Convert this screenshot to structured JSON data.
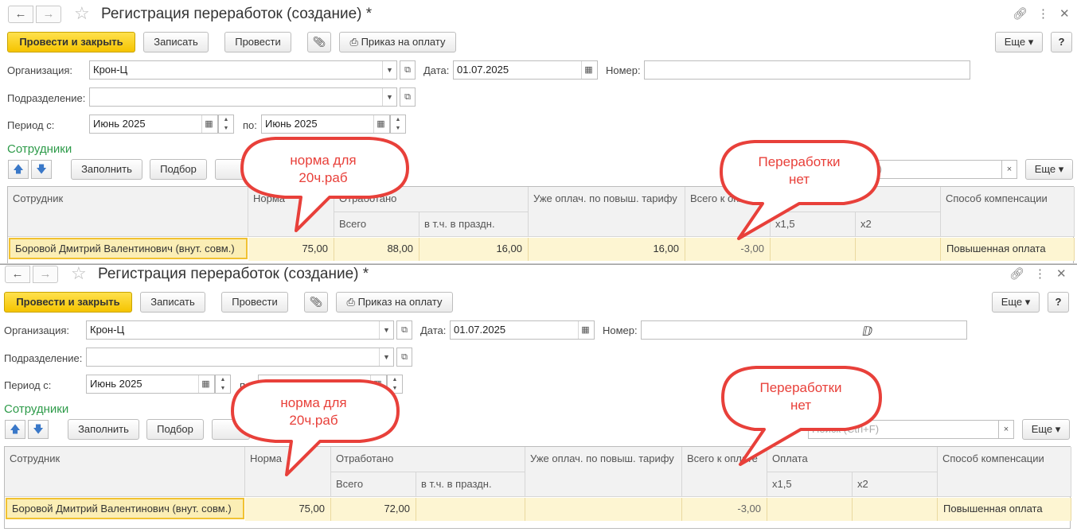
{
  "window": {
    "title": "Регистрация переработок (создание) *",
    "nav_back_icon": "arrow-left-icon",
    "nav_forward_icon": "arrow-right-icon",
    "favorite_icon": "star-icon",
    "link_icon": "link-icon",
    "more_icon": "more-vertical-icon",
    "close_icon": "close-icon"
  },
  "toolbar": {
    "post_close": "Провести и закрыть",
    "save": "Записать",
    "post": "Провести",
    "attach_icon": "paperclip-icon",
    "print_icon": "printer-icon",
    "payment_order": "Приказ на оплату",
    "more": "Еще",
    "help": "?"
  },
  "form": {
    "org_label": "Организация:",
    "org_value": "Крон-Ц",
    "date_label": "Дата:",
    "date_value": "01.07.2025",
    "number_label": "Номер:",
    "number_value": "",
    "dept_label": "Подразделение:",
    "dept_value": "",
    "period_from_label": "Период с:",
    "period_from_value": "Июнь 2025",
    "period_to_label": "по:",
    "period_to_value": "Июнь 2025"
  },
  "employees": {
    "section_title": "Сотрудники",
    "fill": "Заполнить",
    "select": "Подбор",
    "more": "Еще",
    "search_placeholder": "Поиск (Ctrl+F)",
    "clear": "×",
    "columns": {
      "employee": "Сотрудник",
      "norm": "Норма",
      "worked": "Отработано",
      "worked_total": "Всего",
      "worked_holiday": "в т.ч. в праздн.",
      "already_paid": "Уже оплач. по повыш. тарифу",
      "total_pay": "Всего к оплате",
      "payment": "Оплата",
      "x15": "x1,5",
      "x2": "x2",
      "compensation": "Способ компенсации"
    }
  },
  "screens": [
    {
      "row": {
        "employee": "Боровой Дмитрий Валентинович (внут. совм.)",
        "norm": "75,00",
        "worked_total": "88,00",
        "worked_holiday": "16,00",
        "already_paid": "16,00",
        "total_pay": "-3,00",
        "x15": "",
        "x2": "",
        "compensation": "Повышенная оплата"
      },
      "callouts": {
        "norm_note": "норма для\n20ч.раб",
        "overtime_note": "Переработки\nнет"
      }
    },
    {
      "row": {
        "employee": "Боровой Дмитрий Валентинович (внут. совм.)",
        "norm": "75,00",
        "worked_total": "72,00",
        "worked_holiday": "",
        "already_paid": "",
        "total_pay": "-3,00",
        "x15": "",
        "x2": "",
        "compensation": "Повышенная оплата"
      },
      "callouts": {
        "norm_note": "норма для\n20ч.раб",
        "overtime_note": "Переработки\nнет"
      }
    }
  ]
}
